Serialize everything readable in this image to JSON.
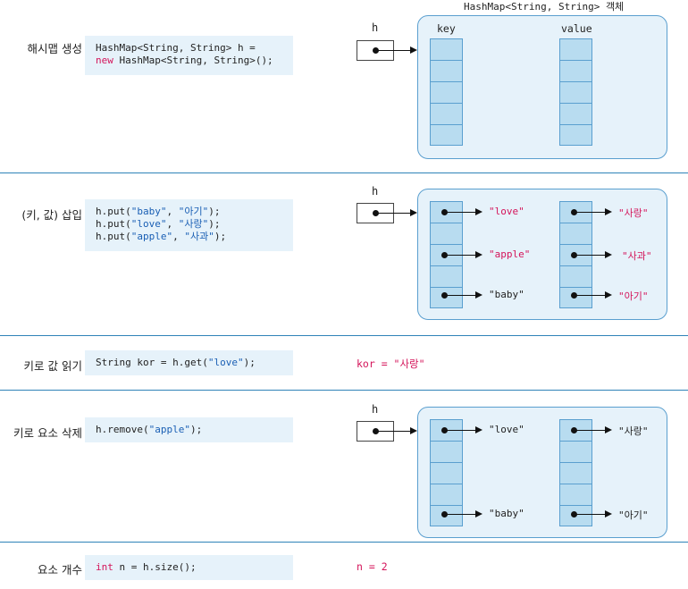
{
  "object_title": "HashMap<String, String> 객체",
  "ref_var": "h",
  "col_key": "key",
  "col_value": "value",
  "sections": {
    "create": {
      "label": "해시맵 생성",
      "code_line1": "HashMap<String, String> h =",
      "code_line2_kw": "new",
      "code_line2_rest": " HashMap<String, String>();"
    },
    "insert": {
      "label": "(키, 값) 삽입",
      "code": [
        {
          "pre": "h.put(",
          "arg1": "\"baby\"",
          "mid": ", ",
          "arg2": "\"아기\"",
          "post": ");"
        },
        {
          "pre": "h.put(",
          "arg1": "\"love\"",
          "mid": ", ",
          "arg2": "\"사랑\"",
          "post": ");"
        },
        {
          "pre": "h.put(",
          "arg1": "\"apple\"",
          "mid": ", ",
          "arg2": "\"사과\"",
          "post": ");"
        }
      ],
      "keys": [
        "\"love\"",
        "\"apple\"",
        "\"baby\""
      ],
      "values": [
        "\"사랑\"",
        "\"사과\"",
        "\"아기\""
      ]
    },
    "get": {
      "label": "키로 값 읽기",
      "code_pre": "String kor = h.get(",
      "code_arg": "\"love\"",
      "code_post": ");",
      "result": "kor = \"사랑\""
    },
    "remove": {
      "label": "키로 요소 삭제",
      "code_pre": "h.remove(",
      "code_arg": "\"apple\"",
      "code_post": ");",
      "keys": [
        "\"love\"",
        "\"baby\""
      ],
      "values": [
        "\"사랑\"",
        "\"아기\""
      ]
    },
    "size": {
      "label": "요소 개수",
      "code_kw": "int",
      "code_rest": " n = h.size();",
      "result": "n = 2"
    }
  },
  "colors": {
    "separator": "#2f83b8",
    "code_bg": "#e6f2fa",
    "keyword": "#d4145a",
    "string": "#1a5fb4",
    "cell_fill": "#b8dcf0"
  }
}
